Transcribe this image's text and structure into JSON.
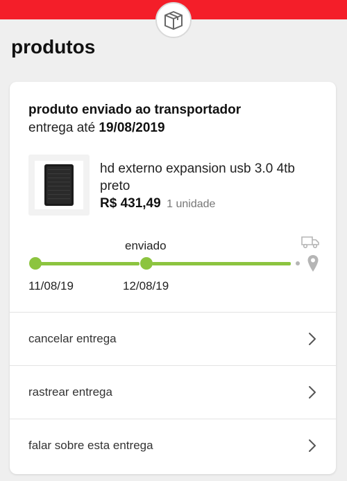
{
  "header": {
    "accent_color": "#f41e29",
    "icon": "package-box-icon",
    "title": "produtos"
  },
  "order": {
    "status": "produto enviado ao transportador",
    "delivery_prefix": "entrega até",
    "delivery_date": "19/08/2019",
    "product": {
      "name": "hd externo expansion usb 3.0 4tb preto",
      "price": "R$ 431,49",
      "quantity": "1 unidade"
    },
    "tracking": {
      "current_step_label": "enviado",
      "steps": [
        {
          "date": "11/08/19"
        },
        {
          "date": "12/08/19"
        }
      ],
      "progress_color": "#8cc43f"
    },
    "actions": [
      {
        "label": "cancelar entrega"
      },
      {
        "label": "rastrear entrega"
      },
      {
        "label": "falar sobre esta entrega"
      }
    ]
  }
}
